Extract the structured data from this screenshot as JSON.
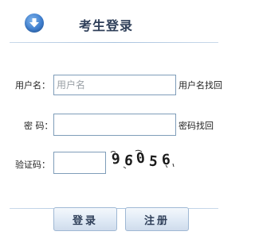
{
  "header": {
    "title": "考生登录",
    "icon": "download-arrow-icon"
  },
  "form": {
    "username": {
      "label": "用户名：",
      "placeholder": "用户名",
      "value": "",
      "link": "用户名找回"
    },
    "password": {
      "label": "密 码：",
      "value": "",
      "link": "密码找回"
    },
    "captcha": {
      "label": "验证码：",
      "value": "",
      "image_text": "96056"
    }
  },
  "buttons": {
    "login": "登录",
    "register": "注册"
  },
  "colors": {
    "accent": "#3f7fcf",
    "title": "#2f3f59",
    "border": "#7f9db9"
  }
}
